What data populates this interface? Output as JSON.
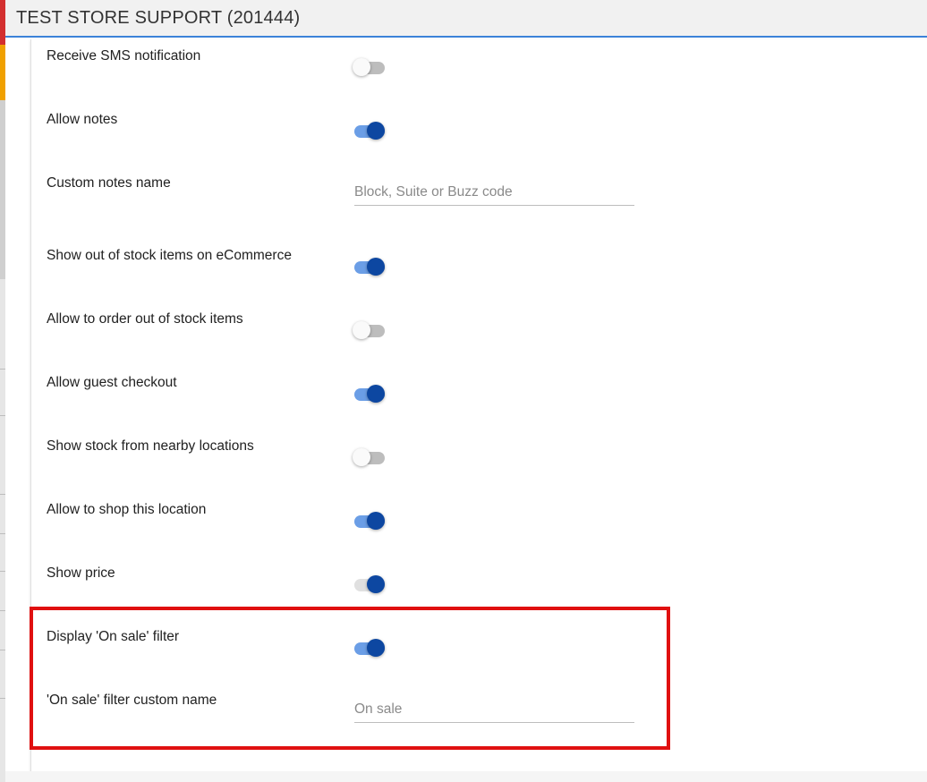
{
  "header": {
    "title": "TEST STORE SUPPORT (201444)"
  },
  "settings": [
    {
      "label": "Receive SMS notification",
      "type": "toggle",
      "state": "off"
    },
    {
      "label": "Allow notes",
      "type": "toggle",
      "state": "on"
    },
    {
      "label": "Custom notes name",
      "type": "input",
      "value": "",
      "placeholder": "Block, Suite or Buzz code"
    },
    {
      "label": "Show out of stock items on eCommerce",
      "type": "toggle",
      "state": "on"
    },
    {
      "label": "Allow to order out of stock items",
      "type": "toggle",
      "state": "off"
    },
    {
      "label": "Allow guest checkout",
      "type": "toggle",
      "state": "on"
    },
    {
      "label": "Show stock from nearby locations",
      "type": "toggle",
      "state": "off"
    },
    {
      "label": "Allow to shop this location",
      "type": "toggle",
      "state": "on"
    },
    {
      "label": "Show price",
      "type": "toggle",
      "state": "on-disabled"
    },
    {
      "label": "Display 'On sale' filter",
      "type": "toggle",
      "state": "on"
    },
    {
      "label": "'On sale' filter custom name",
      "type": "input",
      "value": "",
      "placeholder": "On sale"
    }
  ],
  "colors": {
    "accent": "#3b82d8",
    "toggle_on_thumb": "#0d47a1",
    "toggle_on_track": "#6b9ee6",
    "highlight": "#e01010"
  }
}
